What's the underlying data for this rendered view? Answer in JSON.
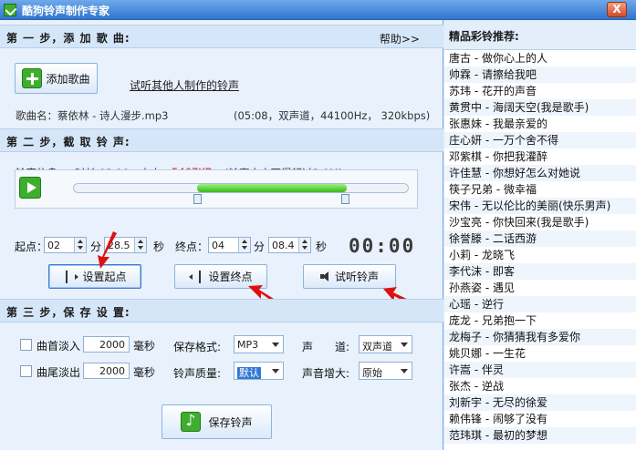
{
  "window": {
    "title": "酷狗铃声制作专家",
    "close_label": "X"
  },
  "step1": {
    "header": "第 一 步，添 加 歌 曲:",
    "help": "帮助>>",
    "add_song_label": "添加歌曲",
    "listen_link": "试听其他人制作的铃声",
    "song_name": "歌曲名：蔡依林 - 诗人漫步.mp3",
    "song_meta": "(05:08，双声道，44100Hz， 320kbps)"
  },
  "step2": {
    "header": "第 二 步，截 取 铃 声:",
    "info_label": "铃声信息：",
    "duration": "时长 02:19，大小",
    "size": "5467KB",
    "size_note": "(铃声大小不得超过2.0M)",
    "start_label": "起点：",
    "start_min": "02",
    "min_unit": "分",
    "start_sec": "28.5",
    "sec_unit": "秒",
    "end_label": "终点：",
    "end_min": "04",
    "end_sec": "08.4",
    "time_display": "00:00",
    "set_start_label": "设置起点",
    "set_end_label": "设置终点",
    "preview_label": "试听铃声",
    "progress": {
      "start_fraction": 0.37,
      "end_fraction": 0.81
    }
  },
  "step3": {
    "header": "第 三 步，保 存 设 置:",
    "fade_in_label": "曲首淡入",
    "fade_in_value": "2000",
    "fade_out_label": "曲尾淡出",
    "fade_out_value": "2000",
    "ms_unit": "毫秒",
    "format_label": "保存格式:",
    "format_value": "MP3",
    "quality_label": "铃声质量:",
    "quality_value": "默认",
    "channel_label": "声　　道:",
    "channel_value": "双声道",
    "boost_label": "声音增大:",
    "boost_value": "原始",
    "save_label": "保存铃声"
  },
  "recommend": {
    "title": "精品彩铃推荐:",
    "songs": [
      "唐古 - 做你心上的人",
      "帅霖 - 请擦给我吧",
      "苏玮 - 花开的声音",
      "黄贯中 - 海阔天空(我是歌手)",
      "张惠妹 - 我最亲爱的",
      "庄心妍 - 一万个舍不得",
      "邓紫棋 - 你把我灌醉",
      "许佳慧 - 你想好怎么对她说",
      "筷子兄弟 - 微幸福",
      "宋伟 - 无以伦比的美丽(快乐男声)",
      "沙宝亮 - 你快回来(我是歌手)",
      "徐誉滕 - 二话西游",
      "小莉 - 龙晓飞",
      "李代沫 - 即客",
      "孙燕姿 - 遇见",
      "心瑶 - 逆行",
      "庞龙 - 兄弟抱一下",
      "龙梅子 - 你猜猜我有多爱你",
      "姚贝娜 - 一生花",
      "许嵩 - 伴灵",
      "张杰 - 逆战",
      "刘新宇 - 无尽的徐爱",
      "赖伟锋 - 闹够了没有",
      "范玮琪 - 最初的梦想"
    ]
  },
  "colors": {
    "accent_red": "#d01a1a",
    "green": "#3fae2f",
    "titlebar": "#2f74cf"
  }
}
